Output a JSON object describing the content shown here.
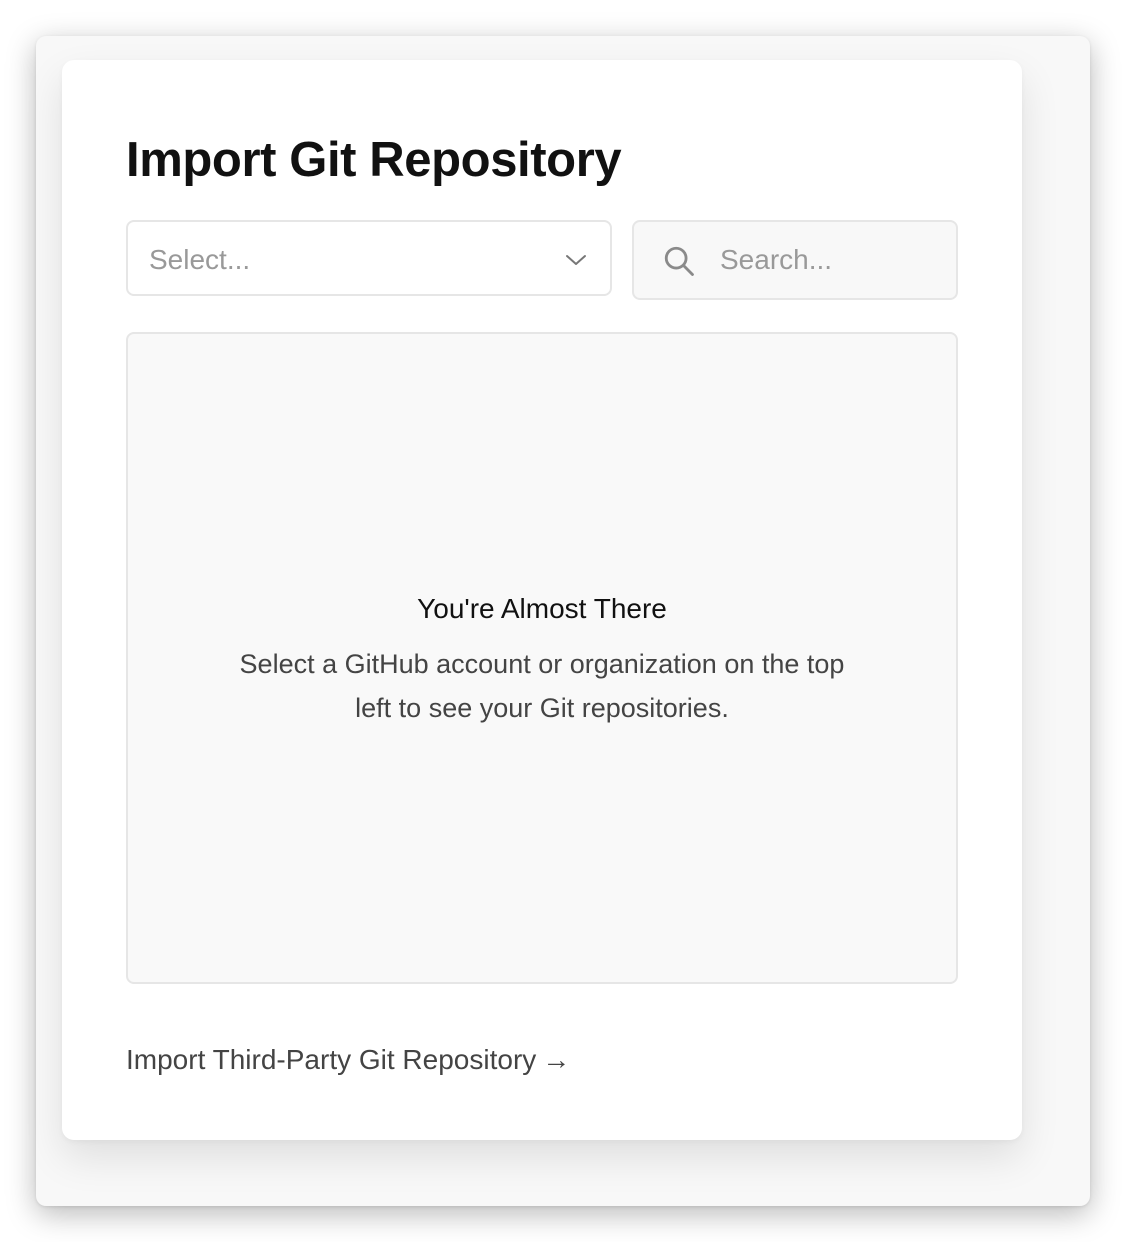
{
  "page": {
    "title": "Import Git Repository"
  },
  "account_select": {
    "placeholder": "Select...",
    "icon": "chevron-down-icon"
  },
  "search": {
    "placeholder": "Search...",
    "value": "",
    "icon": "search-icon"
  },
  "empty_state": {
    "title": "You're Almost There",
    "message": "Select a GitHub account or organization on the top left to see your Git repositories."
  },
  "footer": {
    "third_party_label": "Import Third-Party Git Repository",
    "arrow": "→"
  }
}
